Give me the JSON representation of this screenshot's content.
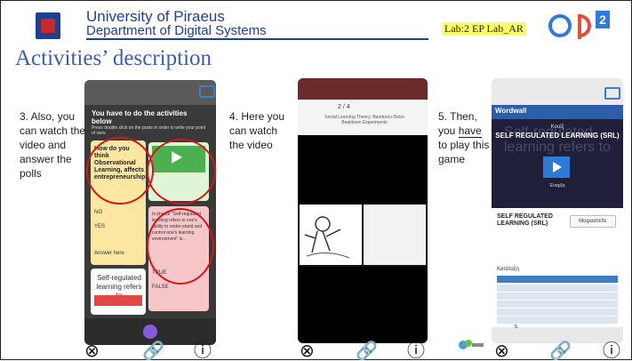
{
  "header": {
    "university_line1": "University of Piraeus",
    "university_line2": "Department of Digital Systems",
    "lab_badge": "Lab:2 EP Lab_AR",
    "logo_text": "ap",
    "logo_sup": "2"
  },
  "slide": {
    "title": "Activities’ description"
  },
  "captions": {
    "c1": "3. Also, you can watch the video and answer the polls",
    "c2": "4. Here you can watch the video",
    "c3_pre": "5. Then, you ",
    "c3_have": "have",
    "c3_post": " to play this game"
  },
  "padlet": {
    "title": "You have to do the activities below",
    "sub": "Press double click on the posts in order to write your point of view",
    "question": "How do you think Observational Learning, affects entrepreneurship?",
    "opt_no": "NO",
    "opt_yes": "YES",
    "answer_here": "Answer here",
    "pink_question": "Is phrase \"Self-regulated learning refers to one's ability to under-stand and control one's learning environment\" is...",
    "opt_true": "TRUE",
    "opt_false": "FALSE",
    "white_card": "Self-regulated learning refers to"
  },
  "video": {
    "header": "2 / 4",
    "sub": "Social Learning Theory: Bandura's Bobo Beatdown Experiments"
  },
  "wordwall": {
    "brand": "Wordwall",
    "kind": "Κουίζ",
    "title": "SELF REGULATED LEARNING (SRL)",
    "bg_text": "Self-regulated learning refers to",
    "start": "Έναρξη",
    "name": "SELF REGULATED LEARNING (SRL)",
    "share": "Μοιραστείτε",
    "leaderboard": "Κατάταξη",
    "row_nums": [
      "1.",
      "2.",
      "3.",
      "4.",
      "5."
    ]
  },
  "controls": {
    "close_glyph": "⊗",
    "link_glyph": "🔗",
    "info_glyph": "ⓘ"
  }
}
